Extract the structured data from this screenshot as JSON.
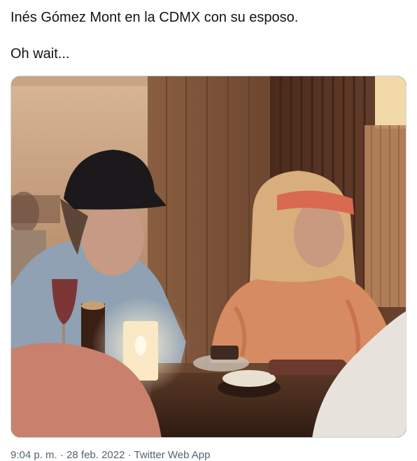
{
  "tweet": {
    "line1": "Inés Gómez Mont en la CDMX con su esposo.",
    "line2": "Oh wait..."
  },
  "media": {
    "kind": "photo",
    "palette": {
      "wall": "#d9b89a",
      "panel_dark": "#5a3826",
      "panel_mid": "#7b5238",
      "lamp": "#f3ddb0",
      "cap": "#1c1a1d",
      "skin": "#caa08a",
      "shirt_man": "#8fa3b6",
      "hair_woman": "#d8b07e",
      "headband": "#d9694f",
      "shirt_woman": "#d98b62",
      "candle": "#fbe8c4",
      "table": "#4a2c1c",
      "foreground_red": "#c9806c",
      "foreground_white": "#e7e3dc"
    }
  },
  "meta": {
    "time": "9:04 p. m.",
    "sep1": " · ",
    "date": "28 feb. 2022",
    "sep2": " · ",
    "source": "Twitter Web App"
  }
}
